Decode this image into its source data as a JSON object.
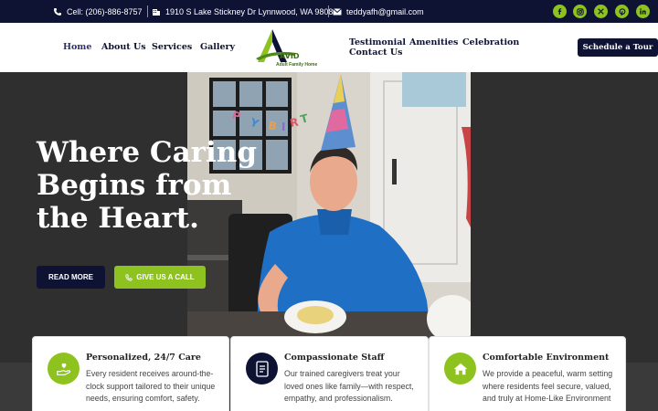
{
  "topbar": {
    "phone": "Cell: (206)-886-8757",
    "address": "1910 S Lake Stickney Dr Lynnwood, WA 98087",
    "email": "teddyafh@gmail.com",
    "social": [
      "facebook-icon",
      "instagram-icon",
      "x-icon",
      "pinterest-icon",
      "linkedin-icon"
    ]
  },
  "nav": {
    "home": "Home",
    "about": "About Us",
    "services": "Services",
    "gallery": "Gallery",
    "testimonial": "Testimonial",
    "amenities": "Amenities",
    "celebration": "Celebration",
    "contact": "Contact Us",
    "schedule": "Schedule a Tour"
  },
  "logo": {
    "mark": "AVID",
    "tagline": "Adult Family Home"
  },
  "hero": {
    "title": "Where Caring Begins from the Heart.",
    "read_more": "READ MORE",
    "give_call": "GIVE US A CALL"
  },
  "cards": [
    {
      "title": "Personalized, 24/7 Care",
      "desc": "Every resident receives around-the-clock support tailored to their unique needs, ensuring comfort, safety.",
      "icon": "caring-hand-icon"
    },
    {
      "title": "Compassionate Staff",
      "desc": "Our trained caregivers treat your loved ones like family—with respect, empathy, and professionalism.",
      "icon": "document-icon"
    },
    {
      "title": "Comfortable Environment",
      "desc": "We provide a peaceful, warm setting where residents feel secure, valued, and truly at Home-Like Environment",
      "icon": "home-icon"
    }
  ],
  "colors": {
    "navy": "#0e1233",
    "green": "#8dc21f",
    "hero_bg": "#2f2f2f"
  }
}
